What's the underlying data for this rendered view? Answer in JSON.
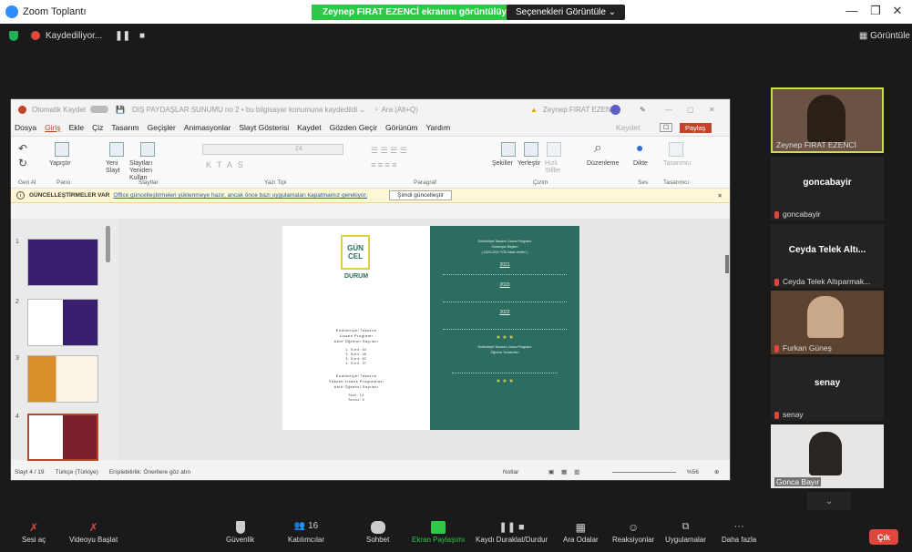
{
  "window": {
    "title": "Zoom Toplantı",
    "share_banner": "Zeynep FIRAT EZENCİ ekranını görüntülüyorsunuz",
    "view_options": "Seçenekleri Görüntüle ⌄"
  },
  "recording": {
    "label": "Kaydediliyor...",
    "view_label": "Görüntüle"
  },
  "ppt": {
    "autosave": "Otomatik Kaydet",
    "filename": "DIŞ PAYDAŞLAR SUNUMU no 2 • bu bilgisayar konumuna kaydedildi ⌄",
    "search": "Ara (Alt+Q)",
    "user": "Zeynep FIRAT EZENCİ",
    "menu": [
      "Dosya",
      "Giriş",
      "Ekle",
      "Çiz",
      "Tasarım",
      "Geçişler",
      "Animasyonlar",
      "Slayt Gösterisi",
      "Kaydet",
      "Gözden Geçir",
      "Görünüm",
      "Yardım"
    ],
    "kaydet_btn": "Kaydet",
    "share_btn": "Paylaş",
    "ribbon_groups": [
      "Geri Al",
      "Pano",
      "Slaytlar",
      "Yazı Tipi",
      "Paragraf",
      "Çizim",
      "Ses",
      "Tasarımcı"
    ],
    "ribbon_labels": {
      "paste": "Yapıştır",
      "new": "Yeni Slayt",
      "reuse": "Slaytları Yeniden Kullan",
      "shapes": "Şekiller",
      "arrange": "Yerleştir",
      "quick": "Hızlı Stiller",
      "edit": "Düzenleme",
      "dictate": "Dikte",
      "designer": "Tasarımcı",
      "font_size": "24"
    },
    "notif_title": "GÜNCELLEŞTİRMELER VAR",
    "notif_text": "Office güncelleştirmeleri yüklenmeye hazır, ancak önce bazı uygulamaları kapatmamız gerekiyor.",
    "notif_btn": "Şimdi güncelleştir",
    "thumb_numbers": [
      "1",
      "2",
      "3",
      "4"
    ],
    "slide": {
      "logo": [
        "GÜN",
        "CEL",
        "DURUM"
      ],
      "left_block1": [
        "Endüstriyel Tasarım",
        "Lisans Programı",
        "Aktif Öğrenci Sayıları"
      ],
      "left_list1": [
        "1. Sınıf: 40",
        "2. Sınıf: 46",
        "3. Sınıf: 52",
        "4. Sınıf: 37"
      ],
      "left_block2": [
        "Endüstriyel Tasarım",
        "Yüksek Lisans Programları",
        "Aktif Öğrenci Sayıları"
      ],
      "left_list2": [
        "Tezli: 14",
        "Tezsiz: 9"
      ],
      "right_title": [
        "Endüstriyel Tasarım Lisans Programı",
        "Kontenjan Bilgileri",
        "( 2020-2022 YÖK Atlas Verileri )"
      ],
      "years": [
        "2021",
        "2020",
        "2022"
      ],
      "stars": "★ ★ ★",
      "right_bottom": [
        "Endüstriyel Tasarım Lisans Programı",
        "Öğrenci Temsilcileri"
      ]
    },
    "status": {
      "slide": "Slayt 4 / 19",
      "lang": "Türkçe (Türkiye)",
      "access": "Erişilebilirlik: Önerilere göz atın",
      "notes": "Notlar",
      "zoom": "%56"
    }
  },
  "participants": [
    {
      "name": "Zeynep FIRAT EZENCİ",
      "video": true
    },
    {
      "name": "goncabayir",
      "label": "goncabayir",
      "video": false
    },
    {
      "name": "Ceyda Telek Altıparmak...",
      "label": "Ceyda Telek Altı...",
      "video": false
    },
    {
      "name": "Furkan Güneş",
      "video": true
    },
    {
      "name": "senay",
      "label": "senay",
      "video": false
    },
    {
      "name": "Gonca Bayır",
      "video": true
    }
  ],
  "toolbar": {
    "audio": "Sesi aç",
    "video": "Videoyu Başlat",
    "security": "Güvenlik",
    "participants": "Katılımcılar",
    "participants_count": "16",
    "chat": "Sohbet",
    "share": "Ekran Paylaşımı",
    "record": "Kaydı Duraklat/Durdur",
    "breakout": "Ara Odalar",
    "reactions": "Reaksiyonlar",
    "apps": "Uygulamalar",
    "more": "Daha fazla",
    "leave": "Çık"
  },
  "colors": {
    "accent": "#2d8cff",
    "share_green": "#2ec748",
    "slide_green": "#2b6d5f",
    "danger": "#e0473c",
    "active_speaker": "#c8e04a"
  }
}
